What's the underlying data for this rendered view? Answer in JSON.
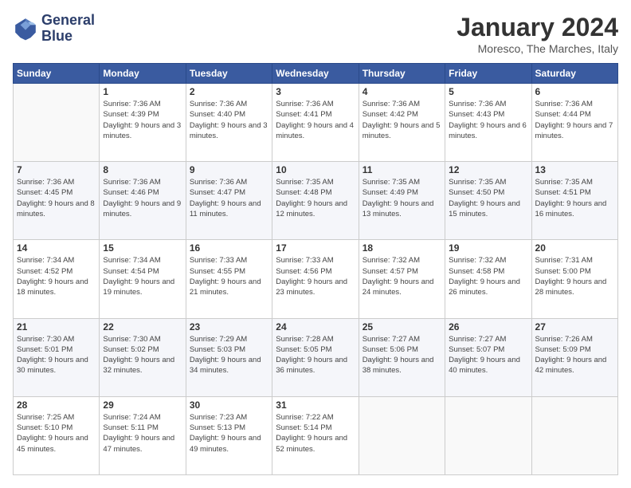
{
  "logo": {
    "line1": "General",
    "line2": "Blue"
  },
  "title": "January 2024",
  "subtitle": "Moresco, The Marches, Italy",
  "days_header": [
    "Sunday",
    "Monday",
    "Tuesday",
    "Wednesday",
    "Thursday",
    "Friday",
    "Saturday"
  ],
  "weeks": [
    [
      {
        "num": "",
        "sunrise": "",
        "sunset": "",
        "daylight": ""
      },
      {
        "num": "1",
        "sunrise": "Sunrise: 7:36 AM",
        "sunset": "Sunset: 4:39 PM",
        "daylight": "Daylight: 9 hours and 3 minutes."
      },
      {
        "num": "2",
        "sunrise": "Sunrise: 7:36 AM",
        "sunset": "Sunset: 4:40 PM",
        "daylight": "Daylight: 9 hours and 3 minutes."
      },
      {
        "num": "3",
        "sunrise": "Sunrise: 7:36 AM",
        "sunset": "Sunset: 4:41 PM",
        "daylight": "Daylight: 9 hours and 4 minutes."
      },
      {
        "num": "4",
        "sunrise": "Sunrise: 7:36 AM",
        "sunset": "Sunset: 4:42 PM",
        "daylight": "Daylight: 9 hours and 5 minutes."
      },
      {
        "num": "5",
        "sunrise": "Sunrise: 7:36 AM",
        "sunset": "Sunset: 4:43 PM",
        "daylight": "Daylight: 9 hours and 6 minutes."
      },
      {
        "num": "6",
        "sunrise": "Sunrise: 7:36 AM",
        "sunset": "Sunset: 4:44 PM",
        "daylight": "Daylight: 9 hours and 7 minutes."
      }
    ],
    [
      {
        "num": "7",
        "sunrise": "Sunrise: 7:36 AM",
        "sunset": "Sunset: 4:45 PM",
        "daylight": "Daylight: 9 hours and 8 minutes."
      },
      {
        "num": "8",
        "sunrise": "Sunrise: 7:36 AM",
        "sunset": "Sunset: 4:46 PM",
        "daylight": "Daylight: 9 hours and 9 minutes."
      },
      {
        "num": "9",
        "sunrise": "Sunrise: 7:36 AM",
        "sunset": "Sunset: 4:47 PM",
        "daylight": "Daylight: 9 hours and 11 minutes."
      },
      {
        "num": "10",
        "sunrise": "Sunrise: 7:35 AM",
        "sunset": "Sunset: 4:48 PM",
        "daylight": "Daylight: 9 hours and 12 minutes."
      },
      {
        "num": "11",
        "sunrise": "Sunrise: 7:35 AM",
        "sunset": "Sunset: 4:49 PM",
        "daylight": "Daylight: 9 hours and 13 minutes."
      },
      {
        "num": "12",
        "sunrise": "Sunrise: 7:35 AM",
        "sunset": "Sunset: 4:50 PM",
        "daylight": "Daylight: 9 hours and 15 minutes."
      },
      {
        "num": "13",
        "sunrise": "Sunrise: 7:35 AM",
        "sunset": "Sunset: 4:51 PM",
        "daylight": "Daylight: 9 hours and 16 minutes."
      }
    ],
    [
      {
        "num": "14",
        "sunrise": "Sunrise: 7:34 AM",
        "sunset": "Sunset: 4:52 PM",
        "daylight": "Daylight: 9 hours and 18 minutes."
      },
      {
        "num": "15",
        "sunrise": "Sunrise: 7:34 AM",
        "sunset": "Sunset: 4:54 PM",
        "daylight": "Daylight: 9 hours and 19 minutes."
      },
      {
        "num": "16",
        "sunrise": "Sunrise: 7:33 AM",
        "sunset": "Sunset: 4:55 PM",
        "daylight": "Daylight: 9 hours and 21 minutes."
      },
      {
        "num": "17",
        "sunrise": "Sunrise: 7:33 AM",
        "sunset": "Sunset: 4:56 PM",
        "daylight": "Daylight: 9 hours and 23 minutes."
      },
      {
        "num": "18",
        "sunrise": "Sunrise: 7:32 AM",
        "sunset": "Sunset: 4:57 PM",
        "daylight": "Daylight: 9 hours and 24 minutes."
      },
      {
        "num": "19",
        "sunrise": "Sunrise: 7:32 AM",
        "sunset": "Sunset: 4:58 PM",
        "daylight": "Daylight: 9 hours and 26 minutes."
      },
      {
        "num": "20",
        "sunrise": "Sunrise: 7:31 AM",
        "sunset": "Sunset: 5:00 PM",
        "daylight": "Daylight: 9 hours and 28 minutes."
      }
    ],
    [
      {
        "num": "21",
        "sunrise": "Sunrise: 7:30 AM",
        "sunset": "Sunset: 5:01 PM",
        "daylight": "Daylight: 9 hours and 30 minutes."
      },
      {
        "num": "22",
        "sunrise": "Sunrise: 7:30 AM",
        "sunset": "Sunset: 5:02 PM",
        "daylight": "Daylight: 9 hours and 32 minutes."
      },
      {
        "num": "23",
        "sunrise": "Sunrise: 7:29 AM",
        "sunset": "Sunset: 5:03 PM",
        "daylight": "Daylight: 9 hours and 34 minutes."
      },
      {
        "num": "24",
        "sunrise": "Sunrise: 7:28 AM",
        "sunset": "Sunset: 5:05 PM",
        "daylight": "Daylight: 9 hours and 36 minutes."
      },
      {
        "num": "25",
        "sunrise": "Sunrise: 7:27 AM",
        "sunset": "Sunset: 5:06 PM",
        "daylight": "Daylight: 9 hours and 38 minutes."
      },
      {
        "num": "26",
        "sunrise": "Sunrise: 7:27 AM",
        "sunset": "Sunset: 5:07 PM",
        "daylight": "Daylight: 9 hours and 40 minutes."
      },
      {
        "num": "27",
        "sunrise": "Sunrise: 7:26 AM",
        "sunset": "Sunset: 5:09 PM",
        "daylight": "Daylight: 9 hours and 42 minutes."
      }
    ],
    [
      {
        "num": "28",
        "sunrise": "Sunrise: 7:25 AM",
        "sunset": "Sunset: 5:10 PM",
        "daylight": "Daylight: 9 hours and 45 minutes."
      },
      {
        "num": "29",
        "sunrise": "Sunrise: 7:24 AM",
        "sunset": "Sunset: 5:11 PM",
        "daylight": "Daylight: 9 hours and 47 minutes."
      },
      {
        "num": "30",
        "sunrise": "Sunrise: 7:23 AM",
        "sunset": "Sunset: 5:13 PM",
        "daylight": "Daylight: 9 hours and 49 minutes."
      },
      {
        "num": "31",
        "sunrise": "Sunrise: 7:22 AM",
        "sunset": "Sunset: 5:14 PM",
        "daylight": "Daylight: 9 hours and 52 minutes."
      },
      {
        "num": "",
        "sunrise": "",
        "sunset": "",
        "daylight": ""
      },
      {
        "num": "",
        "sunrise": "",
        "sunset": "",
        "daylight": ""
      },
      {
        "num": "",
        "sunrise": "",
        "sunset": "",
        "daylight": ""
      }
    ]
  ]
}
